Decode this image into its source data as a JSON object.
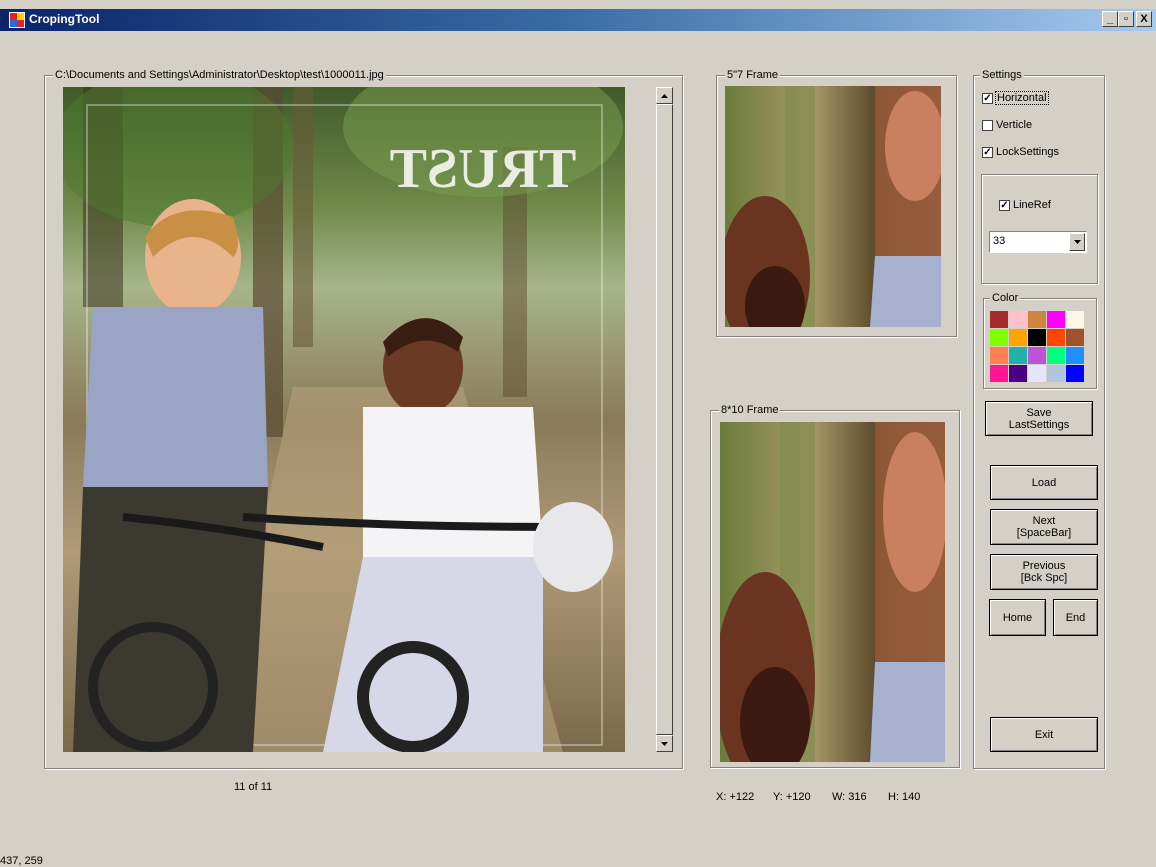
{
  "window": {
    "title": "CropingTool",
    "minimize_label": "_",
    "restore_label": "▫",
    "close_label": "X"
  },
  "main_group": {
    "file_path": "C:\\Documents and Settings\\Administrator\\Desktop\\test\\1000011.jpg",
    "image_counter": "11 of 11",
    "photo_text": "TRUST"
  },
  "frame_5x7": {
    "label": "5\"7 Frame"
  },
  "frame_8x10": {
    "label": "8*10 Frame"
  },
  "crop_info": {
    "x": "X: +122",
    "y": "Y: +120",
    "w": "W: 316",
    "h": "H: 140"
  },
  "settings": {
    "label": "Settings",
    "horizontal": {
      "label": "Horizontal",
      "checked": true
    },
    "verticle": {
      "label": "Verticle",
      "checked": false
    },
    "lock_settings": {
      "label": "LockSettings",
      "checked": true
    },
    "line_ref": {
      "label": "LineRef",
      "checked": true
    },
    "line_ref_value": "33",
    "color_label": "Color",
    "colors": [
      "#a52a2a",
      "#ffc0cb",
      "#cd853f",
      "#ff00ff",
      "#fdf5e6",
      "#7fff00",
      "#ffa500",
      "#000000",
      "#ff4500",
      "#a0522d",
      "#ff7f50",
      "#20b2aa",
      "#ba55d3",
      "#00ff7f",
      "#1e90ff",
      "#ff1493",
      "#4b0082",
      "#e6e6fa",
      "#b0c4de",
      "#0000ff"
    ],
    "save_label": "Save\nLastSettings"
  },
  "nav": {
    "load": "Load",
    "next": "Next\n[SpaceBar]",
    "previous": "Previous\n[Bck Spc]",
    "home": "Home",
    "end": "End",
    "exit": "Exit"
  },
  "status": {
    "coords": "437, 259"
  }
}
